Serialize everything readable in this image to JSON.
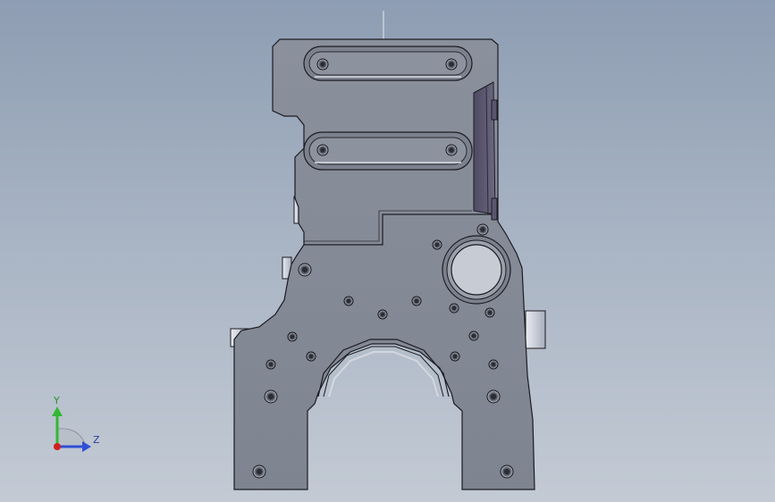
{
  "viewport": {
    "background_top": "#8e9db3",
    "background_bottom": "#c3cad4",
    "model": {
      "face_color": "#868c98",
      "edge_color": "#1c1c22",
      "pocket_color": "#6e7480"
    }
  },
  "triad": {
    "y_label": "Y",
    "z_label": "Z",
    "y_color": "#33b833",
    "z_color": "#2f4fd6",
    "x_color": "#d02020"
  }
}
